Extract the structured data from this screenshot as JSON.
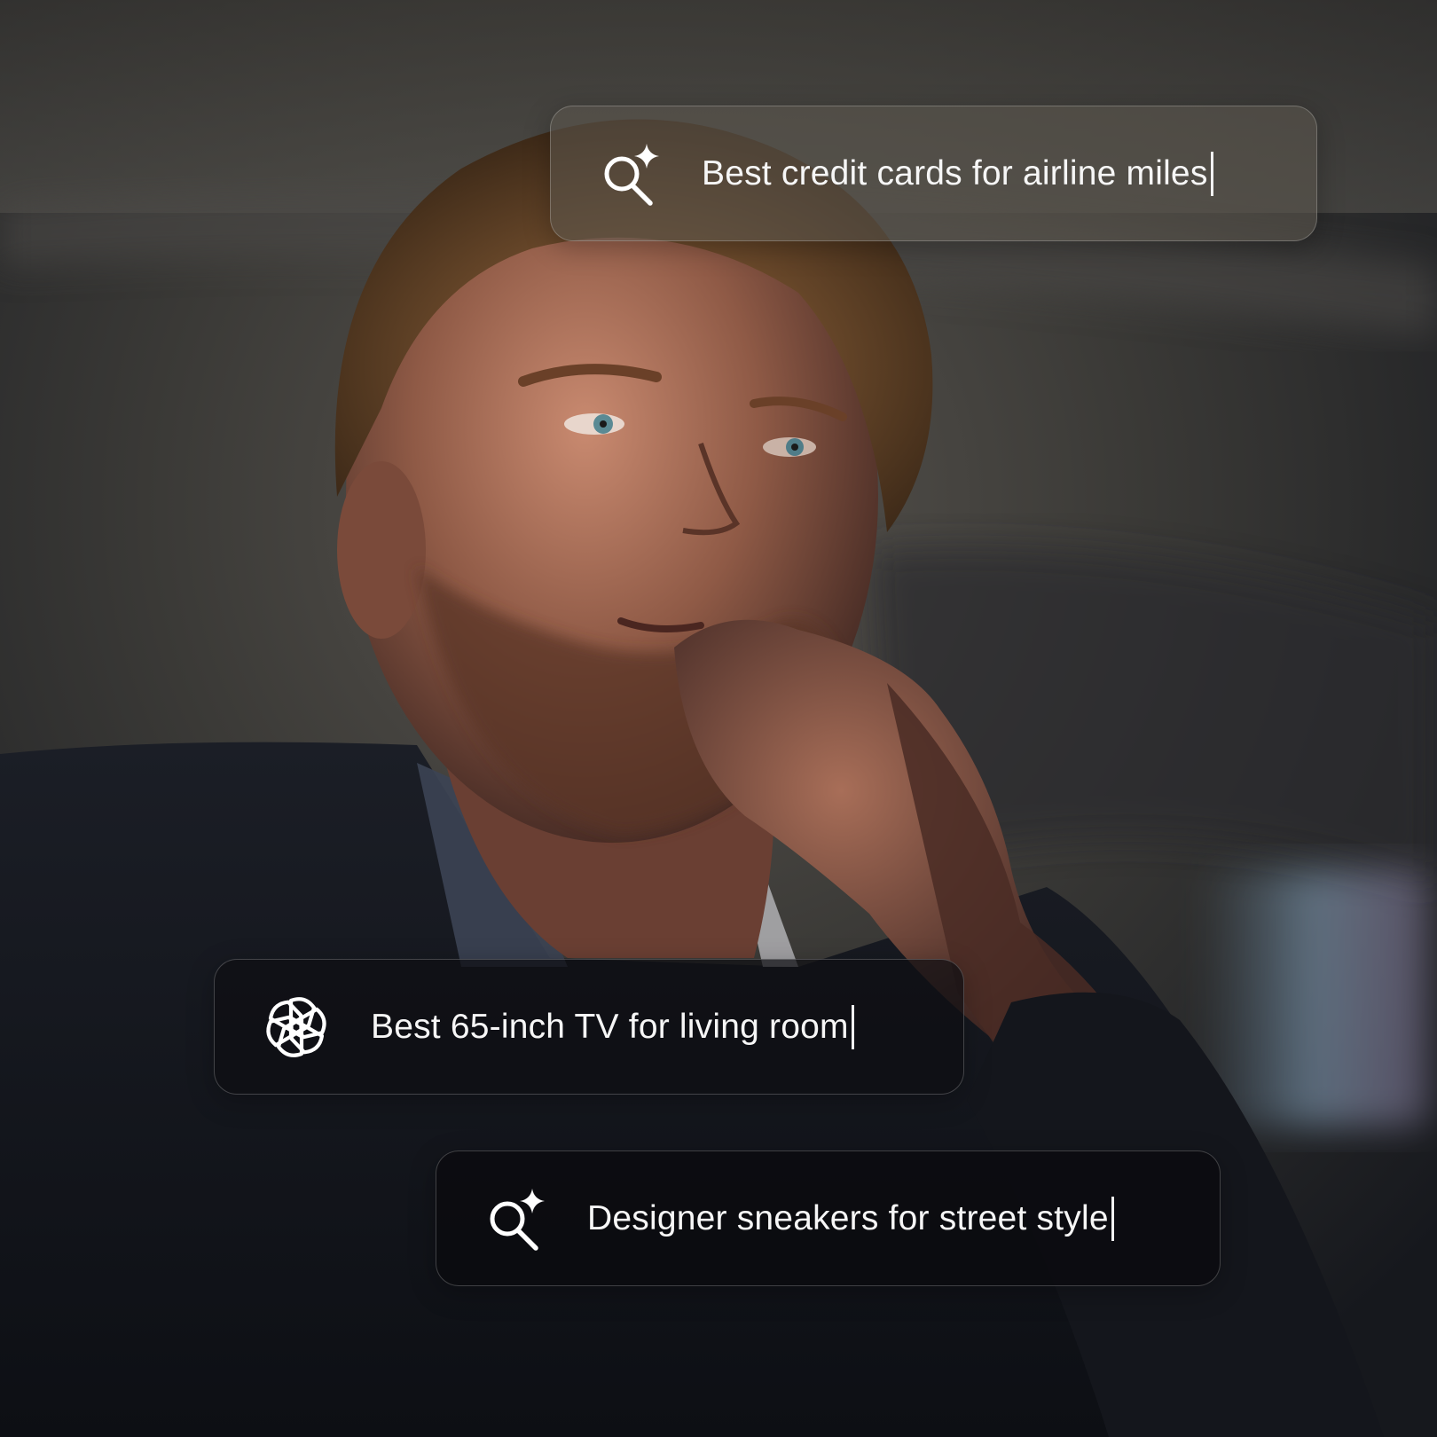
{
  "scene": {
    "description_icon": "man-portrait-photo"
  },
  "queries": [
    {
      "text": "Best credit cards for airline miles",
      "icon": "ai-search-sparkle-icon"
    },
    {
      "text": "Best 65-inch TV for living room",
      "icon": "openai-logo-icon"
    },
    {
      "text": "Designer sneakers for street style",
      "icon": "ai-search-sparkle-icon"
    }
  ],
  "colors": {
    "bar_text": "#f6f6f6",
    "bar_border": "rgba(255,255,255,0.22)"
  }
}
